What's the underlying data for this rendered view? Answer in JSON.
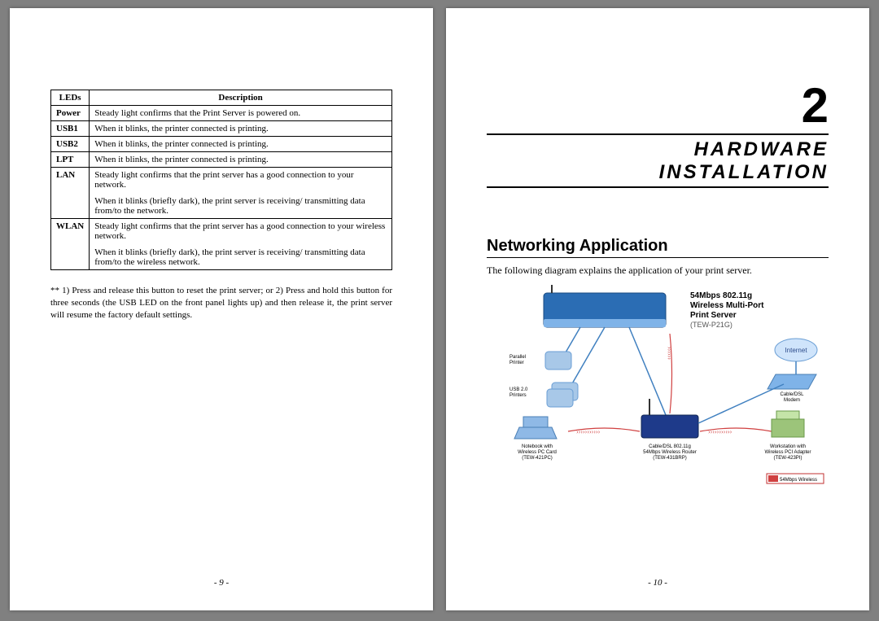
{
  "left": {
    "table": {
      "header": {
        "c1": "LEDs",
        "c2": "Description"
      },
      "rows": [
        {
          "label": "Power",
          "text": "Steady light confirms that the Print Server is powered on."
        },
        {
          "label": "USB1",
          "text": "When it blinks, the printer connected is printing."
        },
        {
          "label": "USB2",
          "text": "When it blinks, the printer connected is printing."
        },
        {
          "label": "LPT",
          "text": "When it blinks, the printer connected is printing."
        },
        {
          "label": "LAN",
          "text": "Steady light confirms that the print server has a good connection to your network.",
          "text2": "When it blinks (briefly dark), the print server is receiving/ transmitting data from/to the network."
        },
        {
          "label": "WLAN",
          "text": "Steady light confirms that the print server has a good connection to your wireless network.",
          "text2": "When it blinks (briefly dark), the print server is receiving/ transmitting data from/to the wireless network."
        }
      ]
    },
    "footnote": "** 1) Press and release this button to reset the print server; or 2) Press and hold this button for three seconds (the USB LED on the front panel lights up) and then release it, the print server will resume the factory default settings.",
    "page_num": "- 9 -"
  },
  "right": {
    "chapter_num": "2",
    "chapter_title_l1": "HARDWARE",
    "chapter_title_l2": "INSTALLATION",
    "section_title": "Networking Application",
    "section_text": "The following diagram explains the application of your print server.",
    "diagram": {
      "product_title_l1": "54Mbps 802.11g",
      "product_title_l2": "Wireless Multi-Port",
      "product_title_l3": "Print Server",
      "product_model": "(TEW-P21G)",
      "parallel_printer": "Parallel\nPrinter",
      "usb_printers": "USB 2.0\nPrinters",
      "internet": "Internet",
      "modem": "Cable/DSL\nModem",
      "router_l1": "Cable/DSL 802.11g",
      "router_l2": "54Mbps Wireless Router",
      "router_l3": "(TEW-431BRP)",
      "notebook_l1": "Notebook with",
      "notebook_l2": "Wireless PC Card",
      "notebook_l3": "(TEW-421PC)",
      "workstation_l1": "Workstation with",
      "workstation_l2": "Wireless PCI Adapter",
      "workstation_l3": "(TEW-423PI)",
      "badge": "54Mbps Wireless"
    },
    "page_num": "- 10 -"
  }
}
